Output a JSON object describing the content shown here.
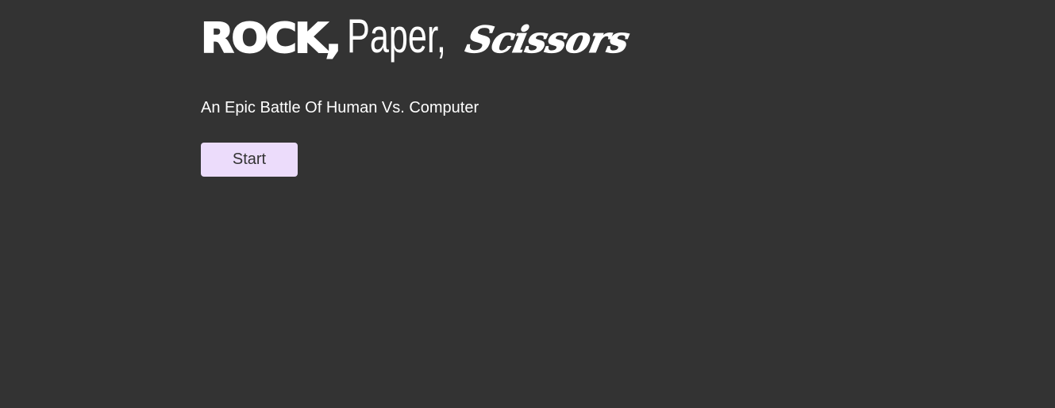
{
  "header": {
    "title_rock": "ROCK,",
    "title_paper": "Paper,",
    "title_scissors": "Scissors"
  },
  "main": {
    "subtitle": "An Epic Battle Of Human Vs. Computer",
    "start_label": "Start"
  },
  "colors": {
    "background": "#333333",
    "text": "#ffffff",
    "button_bg": "#ecdcfb",
    "button_text": "#333333"
  }
}
